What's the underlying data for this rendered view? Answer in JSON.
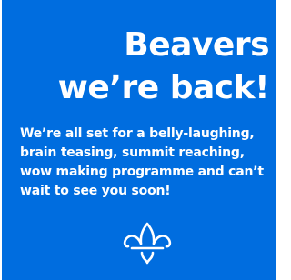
{
  "headline": {
    "line1": "Beavers",
    "line2": "we’re back!"
  },
  "body": "We’re all set for a belly-laughing, brain teasing, summit reaching, wow making programme and can’t wait to see you soon!",
  "logo_icon": "scout-fleur-de-lis-icon",
  "colors": {
    "background": "#006ddf",
    "text": "#ffffff"
  }
}
